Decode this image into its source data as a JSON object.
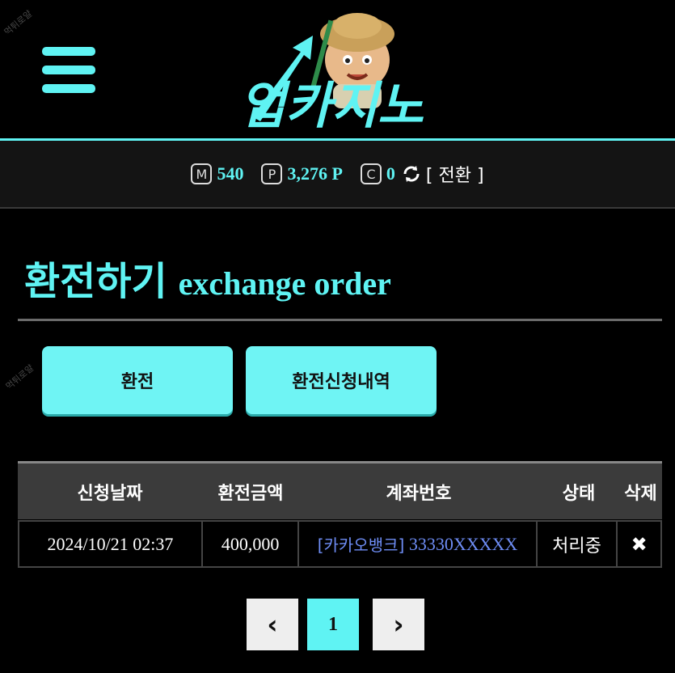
{
  "header": {
    "logo_text": "업카지노",
    "watermark": "먹튀로얄"
  },
  "balance": {
    "money_icon": "M",
    "money_value": "540",
    "point_icon": "P",
    "point_value": "3,276 P",
    "coin_icon": "C",
    "coin_value": "0",
    "convert_label": "[ 전환 ]"
  },
  "page": {
    "title_ko": "환전하기",
    "title_en": "exchange order"
  },
  "tabs": {
    "exchange": "환전",
    "history": "환전신청내역"
  },
  "table": {
    "headers": [
      "신청날짜",
      "환전금액",
      "계좌번호",
      "상태",
      "삭제"
    ],
    "rows": [
      {
        "date": "2024/10/21 02:37",
        "amount": "400,000",
        "bank": "[카카오뱅크]",
        "account": "33330XXXXX",
        "status": "처리중",
        "delete": "✖"
      }
    ]
  },
  "pagination": {
    "prev": "‹",
    "current": "1",
    "next": "›"
  },
  "colors": {
    "accent": "#5ff3f3",
    "account_link": "#6e8df5",
    "background": "#000000"
  }
}
